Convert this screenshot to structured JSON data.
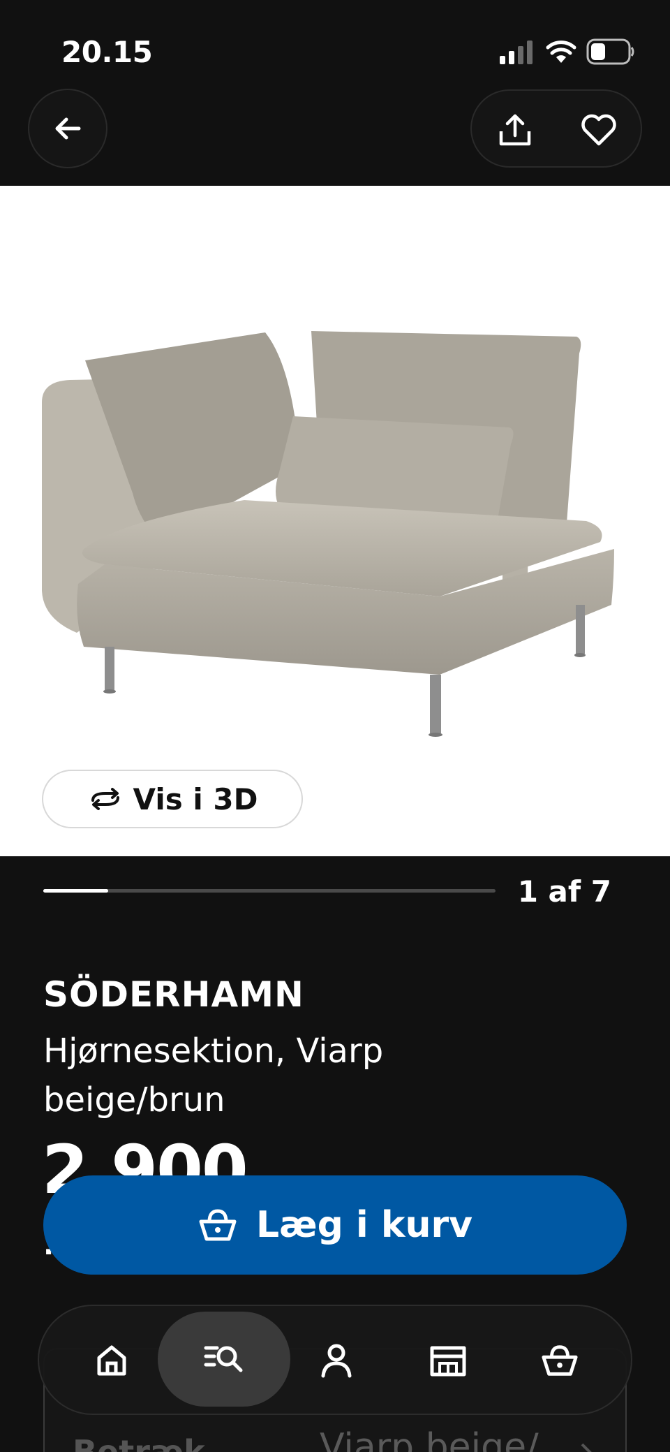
{
  "status_bar": {
    "time": "20.15",
    "icons": [
      "cellular-signal-icon",
      "wifi-icon",
      "battery-icon"
    ]
  },
  "top_nav": {
    "icons": [
      "arrow-left-icon",
      "share-icon",
      "heart-icon"
    ]
  },
  "gallery": {
    "view_3d_label": "Vis i 3D",
    "view_3d_icon": "rotate-3d-icon",
    "counter": "1 af 7",
    "progress": 0.1429
  },
  "product": {
    "name": "SÖDERHAMN",
    "description": "Hjørnesektion, Viarp beige/brun",
    "price": "2.900",
    "price_suffix": ".-"
  },
  "cart": {
    "label": "Læg i kurv",
    "icon": "basket-icon"
  },
  "details": {
    "label": "Betræk",
    "value": "Viarp beige/"
  },
  "bottom_nav": {
    "items": [
      "home-icon",
      "search-list-icon",
      "profile-icon",
      "store-icon",
      "basket-icon"
    ]
  },
  "colors": {
    "background": "#111111",
    "accent_blue": "#0058a3",
    "image_background": "#ffffff"
  }
}
